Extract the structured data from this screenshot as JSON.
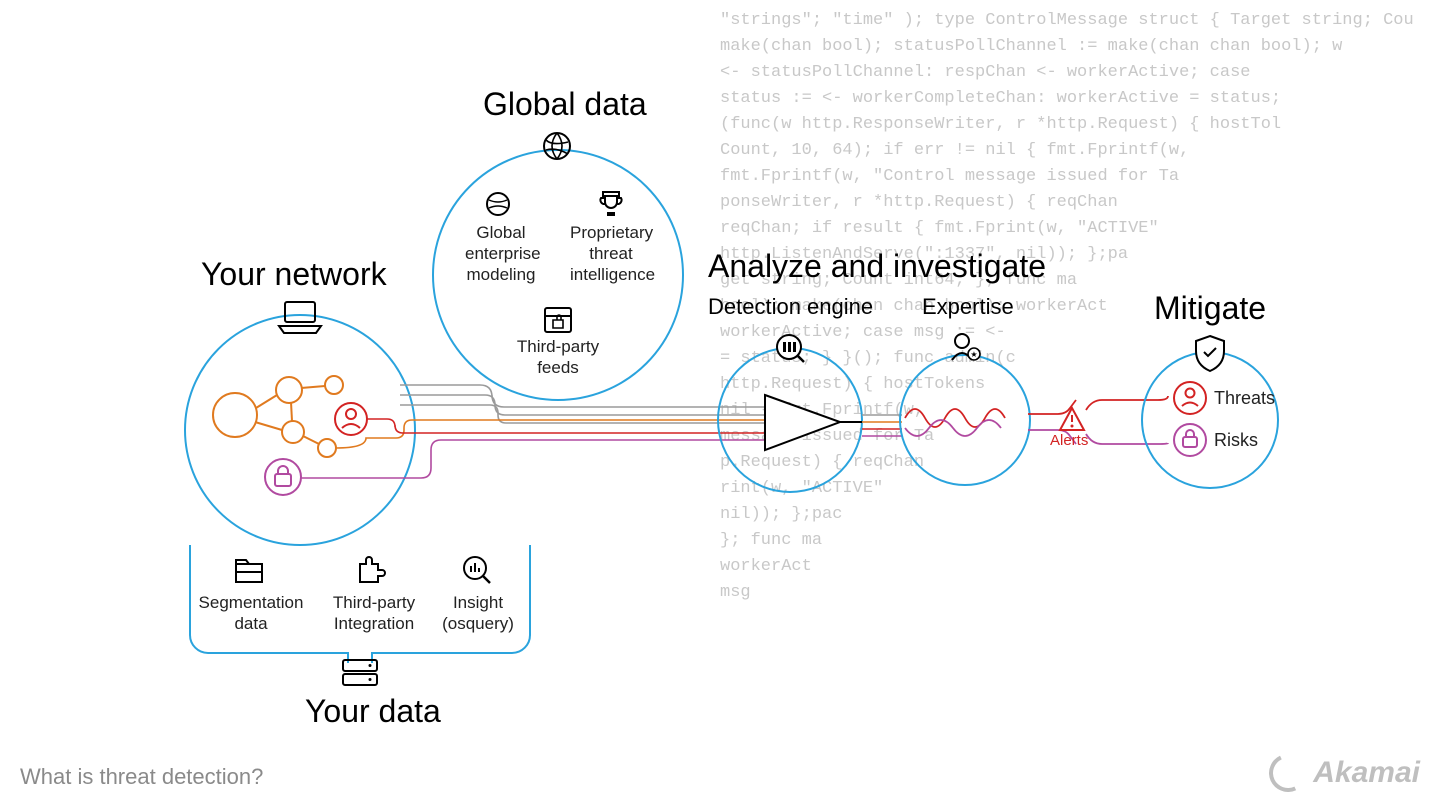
{
  "footer_caption": "What is threat detection?",
  "brand": "Akamai",
  "sections": {
    "global": {
      "title": "Global data",
      "items": [
        "Global\nenterprise\nmodeling",
        "Proprietary\nthreat\nintelligence",
        "Third-party\nfeeds"
      ]
    },
    "network": {
      "title": "Your network"
    },
    "yourdata": {
      "title": "Your data",
      "items": [
        "Segmentation\ndata",
        "Third-party\nIntegration",
        "Insight\n(osquery)"
      ]
    },
    "analyze": {
      "title": "Analyze and investigate",
      "detection": "Detection engine",
      "expertise": "Expertise"
    },
    "mitigate": {
      "title": "Mitigate",
      "outputs": [
        "Threats",
        "Risks"
      ]
    },
    "alerts": "Alerts"
  },
  "colors": {
    "circle": "#2aa3dd",
    "orange": "#e07a1f",
    "red": "#d32323",
    "purple": "#b14aa0",
    "gray": "#666",
    "lightgray": "#c8c8c8"
  },
  "bg_code": "\"strings\"; \"time\" ); type ControlMessage struct { Target string; Cou\nmake(chan bool); statusPollChannel := make(chan chan bool); w\n<- statusPollChannel: respChan <- workerActive; case\nstatus := <- workerCompleteChan: workerActive = status;\n(func(w http.ResponseWriter, r *http.Request) { hostTol\nCount, 10, 64); if err != nil { fmt.Fprintf(w,\nfmt.Fprintf(w, \"Control message issued for Ta\nponseWriter, r *http.Request) { reqChan\nreqChan; if result { fmt.Fprint(w, \"ACTIVE\"\nhttp.ListenAndServe(\":1337\", nil)); };pa\nget string; Count int64; }; func ma\nbool); make(chan chan bool); workerAct\nworkerActive; case msg := <-\n= status; } }(); func admin(c\nhttp.Request) { hostTokens\nnil { fmt.Fprintf(w,\nmessage issued for Ta\np.Request) { reqChan\nrint(w, \"ACTIVE\"\nnil)); };pac\n}; func ma\nworkerAct\nmsg"
}
